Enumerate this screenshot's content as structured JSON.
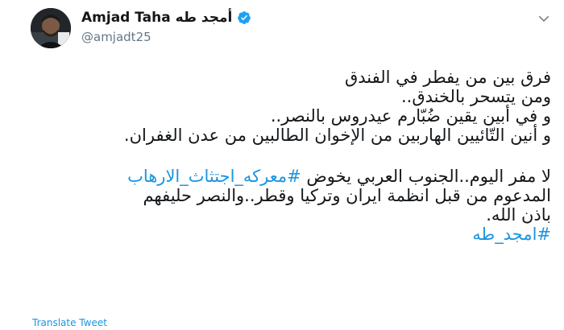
{
  "author": {
    "display_name": "Amjad Taha أمجد طه",
    "handle": "@amjadt25",
    "verified": true
  },
  "tweet": {
    "lines_paragraph1": [
      "فرق بين من يفطر في الفندق",
      "ومن يتسحر بالخندق..",
      "و في أبين يقين ضُبّارم عيدروس بالنصر..",
      "و أنين التّائيين الهاربين من الإخوان الطالبين من عدن الغفران."
    ],
    "line5_text": "لا مفر اليوم..الجنوب العربي يخوض ",
    "line5_hashtag": "#معركه_اجتثاث_الارهاب",
    "line6_text": "المدعوم من قبل انظمة ايران وتركيا وقطر..والنصر حليفهم",
    "line7_text": "باذن الله.",
    "line8_hashtag": "#امجد_طه"
  },
  "actions": {
    "translate_label": "Translate Tweet"
  },
  "colors": {
    "link": "#1b95e0",
    "verified_badge": "#1da1f2",
    "secondary_text": "#657786"
  },
  "icons": {
    "verified": "verified-badge-icon",
    "menu": "chevron-down-icon"
  }
}
